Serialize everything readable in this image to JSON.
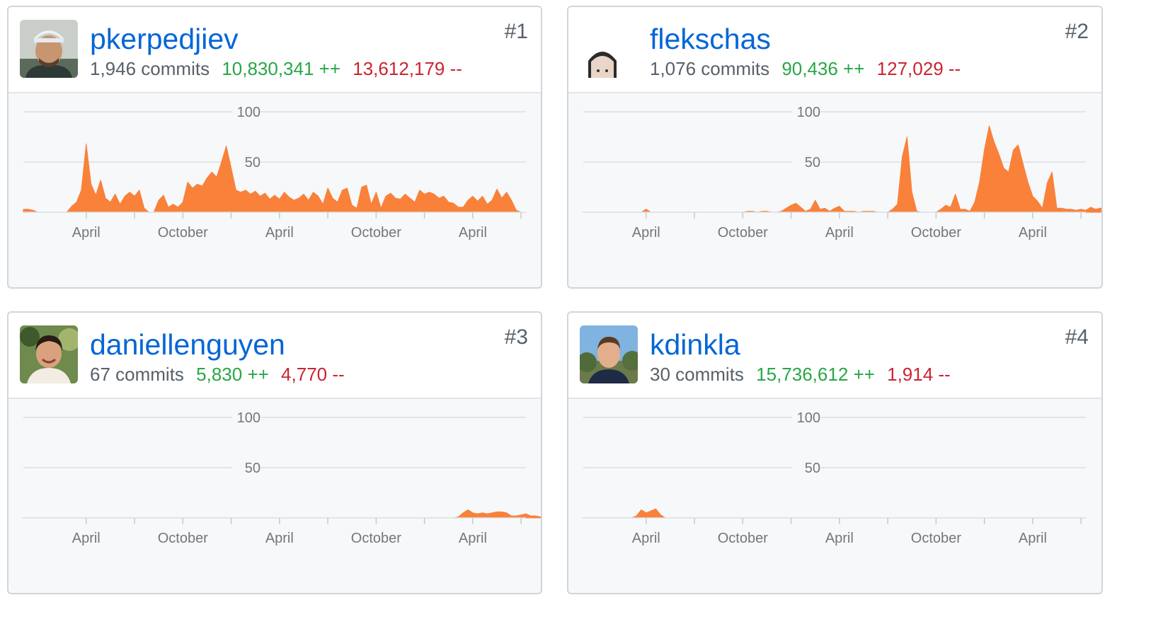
{
  "colors": {
    "area": "#f9813a",
    "grid": "#dcdfe3",
    "tick_label": "#767676",
    "link": "#0366d6",
    "additions": "#28a745",
    "deletions": "#cb2431"
  },
  "contributors": [
    {
      "rank": "#1",
      "username": "pkerpedjiev",
      "commits": "1,946 commits",
      "additions": "10,830,341 ++",
      "deletions": "13,612,179 --",
      "avatar": "photo-icon"
    },
    {
      "rank": "#2",
      "username": "flekschas",
      "commits": "1,076 commits",
      "additions": "90,436 ++",
      "deletions": "127,029 --",
      "avatar": "photo-icon"
    },
    {
      "rank": "#3",
      "username": "daniellenguyen",
      "commits": "67 commits",
      "additions": "5,830 ++",
      "deletions": "4,770 --",
      "avatar": "photo-icon"
    },
    {
      "rank": "#4",
      "username": "kdinkla",
      "commits": "30 commits",
      "additions": "15,736,612 ++",
      "deletions": "1,914 --",
      "avatar": "photo-icon"
    }
  ],
  "chart_data": [
    {
      "type": "area",
      "y_ticks": [
        50,
        100
      ],
      "ylim": [
        0,
        100
      ],
      "xlim": [
        0,
        104
      ],
      "x_ticks": [
        {
          "x": 13,
          "label": "April"
        },
        {
          "x": 33,
          "label": "October"
        },
        {
          "x": 53,
          "label": "April"
        },
        {
          "x": 73,
          "label": "October"
        },
        {
          "x": 93,
          "label": "April"
        }
      ],
      "x_tick_marks": [
        13,
        23,
        33,
        43,
        53,
        63,
        73,
        83,
        93,
        103
      ],
      "values": [
        3,
        3,
        2,
        0,
        0,
        0,
        0,
        0,
        0,
        0,
        6,
        10,
        22,
        68,
        28,
        17,
        32,
        14,
        10,
        18,
        8,
        16,
        20,
        16,
        22,
        4,
        0,
        0,
        12,
        17,
        5,
        8,
        5,
        10,
        30,
        24,
        28,
        26,
        34,
        40,
        35,
        50,
        66,
        44,
        22,
        20,
        22,
        18,
        21,
        16,
        19,
        13,
        17,
        13,
        20,
        15,
        12,
        14,
        18,
        12,
        20,
        16,
        8,
        24,
        14,
        10,
        22,
        24,
        7,
        4,
        25,
        27,
        8,
        20,
        4,
        16,
        19,
        14,
        13,
        18,
        14,
        10,
        22,
        18,
        20,
        18,
        14,
        16,
        10,
        9,
        5,
        5,
        12,
        16,
        11,
        16,
        8,
        12,
        23,
        14,
        20,
        12,
        2,
        0,
        0
      ],
      "grid": true,
      "legend": "none"
    },
    {
      "type": "area",
      "y_ticks": [
        50,
        100
      ],
      "ylim": [
        0,
        100
      ],
      "xlim": [
        0,
        104
      ],
      "x_ticks": [
        {
          "x": 13,
          "label": "April"
        },
        {
          "x": 33,
          "label": "October"
        },
        {
          "x": 53,
          "label": "April"
        },
        {
          "x": 73,
          "label": "October"
        },
        {
          "x": 93,
          "label": "April"
        }
      ],
      "x_tick_marks": [
        13,
        23,
        33,
        43,
        53,
        63,
        73,
        83,
        93,
        103
      ],
      "values": [
        0,
        0,
        0,
        0,
        0,
        0,
        0,
        0,
        0,
        0,
        0,
        0,
        0,
        3,
        0,
        0,
        0,
        0,
        0,
        0,
        0,
        0,
        0,
        0,
        0,
        0,
        0,
        0,
        0,
        0,
        0,
        0,
        0,
        0,
        1,
        1,
        0,
        1,
        1,
        0,
        0,
        1,
        4,
        7,
        9,
        5,
        1,
        3,
        12,
        3,
        4,
        1,
        4,
        6,
        1,
        1,
        1,
        0,
        1,
        1,
        1,
        0,
        0,
        0,
        3,
        8,
        55,
        75,
        20,
        1,
        0,
        0,
        0,
        0,
        3,
        7,
        5,
        18,
        3,
        3,
        1,
        10,
        30,
        62,
        86,
        70,
        58,
        44,
        40,
        62,
        67,
        48,
        30,
        16,
        11,
        4,
        29,
        40,
        4,
        4,
        3,
        3,
        2,
        3,
        2,
        5,
        3,
        4,
        5
      ],
      "grid": true,
      "legend": "none"
    },
    {
      "type": "area",
      "y_ticks": [
        50,
        100
      ],
      "ylim": [
        0,
        100
      ],
      "xlim": [
        0,
        104
      ],
      "x_ticks": [
        {
          "x": 13,
          "label": "April"
        },
        {
          "x": 33,
          "label": "October"
        },
        {
          "x": 53,
          "label": "April"
        },
        {
          "x": 73,
          "label": "October"
        },
        {
          "x": 93,
          "label": "April"
        }
      ],
      "x_tick_marks": [
        13,
        23,
        33,
        43,
        53,
        63,
        73,
        83,
        93,
        103
      ],
      "values": [
        0,
        0,
        0,
        0,
        0,
        0,
        0,
        0,
        0,
        0,
        0,
        0,
        0,
        0,
        0,
        0,
        0,
        0,
        0,
        0,
        0,
        0,
        0,
        0,
        0,
        0,
        0,
        0,
        0,
        0,
        0,
        0,
        0,
        0,
        0,
        0,
        0,
        0,
        0,
        0,
        0,
        0,
        0,
        0,
        0,
        0,
        0,
        0,
        0,
        0,
        0,
        0,
        0,
        0,
        0,
        0,
        0,
        0,
        0,
        0,
        0,
        0,
        0,
        0,
        0,
        0,
        0,
        0,
        0,
        0,
        0,
        0,
        0,
        0,
        0,
        0,
        0,
        0,
        0,
        0,
        0,
        0,
        0,
        0,
        0,
        0,
        0,
        0,
        0,
        0,
        1,
        5,
        8,
        5,
        4,
        5,
        4,
        5,
        6,
        6,
        5,
        2,
        2,
        3,
        4,
        2,
        2,
        1,
        0
      ],
      "grid": true,
      "legend": "none"
    },
    {
      "type": "area",
      "y_ticks": [
        50,
        100
      ],
      "ylim": [
        0,
        100
      ],
      "xlim": [
        0,
        104
      ],
      "x_ticks": [
        {
          "x": 13,
          "label": "April"
        },
        {
          "x": 33,
          "label": "October"
        },
        {
          "x": 53,
          "label": "April"
        },
        {
          "x": 73,
          "label": "October"
        },
        {
          "x": 93,
          "label": "April"
        }
      ],
      "x_tick_marks": [
        13,
        23,
        33,
        43,
        53,
        63,
        73,
        83,
        93,
        103
      ],
      "values": [
        0,
        0,
        0,
        0,
        0,
        0,
        0,
        0,
        0,
        0,
        0,
        2,
        8,
        5,
        7,
        9,
        3,
        0,
        0,
        0,
        0,
        0,
        0,
        0,
        0,
        0,
        0,
        0,
        0,
        0,
        0,
        0,
        0,
        0,
        0,
        0,
        0,
        0,
        0,
        0,
        0,
        0,
        0,
        0,
        0,
        0,
        0,
        0,
        0,
        0,
        0,
        0,
        0,
        0,
        0,
        0,
        0,
        0,
        0,
        0,
        0,
        0,
        0,
        0,
        0,
        0,
        0,
        0,
        0,
        0,
        0,
        0,
        0,
        0,
        0,
        0,
        0,
        0,
        0,
        0,
        0,
        0,
        0,
        0,
        0,
        0,
        0,
        0,
        0,
        0,
        0,
        0,
        0,
        0,
        0,
        0,
        0,
        0,
        0,
        0,
        0,
        0,
        0,
        0,
        0
      ],
      "grid": true,
      "legend": "none"
    }
  ]
}
